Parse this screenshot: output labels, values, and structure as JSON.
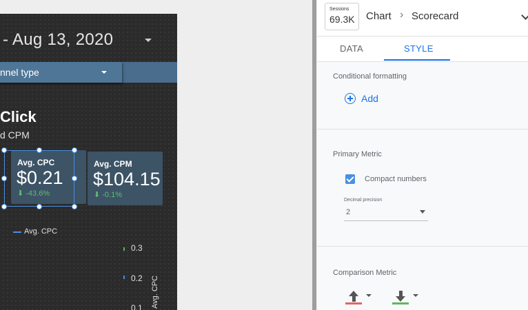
{
  "report": {
    "date_range": "- Aug 13, 2020",
    "channel_filter": "nnel type",
    "title": "Click",
    "subtitle": "d CPM",
    "scorecards": [
      {
        "label": "Avg. CPC",
        "value": "$0.21",
        "change": "⬇ -43.6%"
      },
      {
        "label": "Avg. CPM",
        "value": "$104.15",
        "change": "⬇ -0.1%"
      }
    ],
    "legend_label": "Avg. CPC",
    "axis_ticks": [
      "0.3",
      "0.2",
      "0.1"
    ],
    "axis_title": "Avg. CPC"
  },
  "panel": {
    "thumb_label": "Sessions",
    "thumb_value": "69.3K",
    "breadcrumb_1": "Chart",
    "breadcrumb_sep": "›",
    "breadcrumb_2": "Scorecard",
    "tabs": [
      {
        "label": "DATA"
      },
      {
        "label": "STYLE"
      }
    ],
    "active_tab": "STYLE",
    "conditional_formatting": {
      "title": "Conditional formatting",
      "add_label": "Add"
    },
    "primary_metric": {
      "title": "Primary Metric",
      "compact_numbers_label": "Compact numbers",
      "compact_numbers_checked": true,
      "decimal_precision_label": "Decimal precision",
      "decimal_precision_value": "2"
    },
    "comparison_metric": {
      "title": "Comparison Metric",
      "positive_color": "#5f9e5f",
      "negative_color": "#d9534f"
    }
  },
  "colors": {
    "accent": "#1a73e8",
    "selection": "#4a90e2",
    "positive_change": "#5fbf72",
    "increase_bar": "#e06666",
    "decrease_bar": "#5cb85c"
  }
}
